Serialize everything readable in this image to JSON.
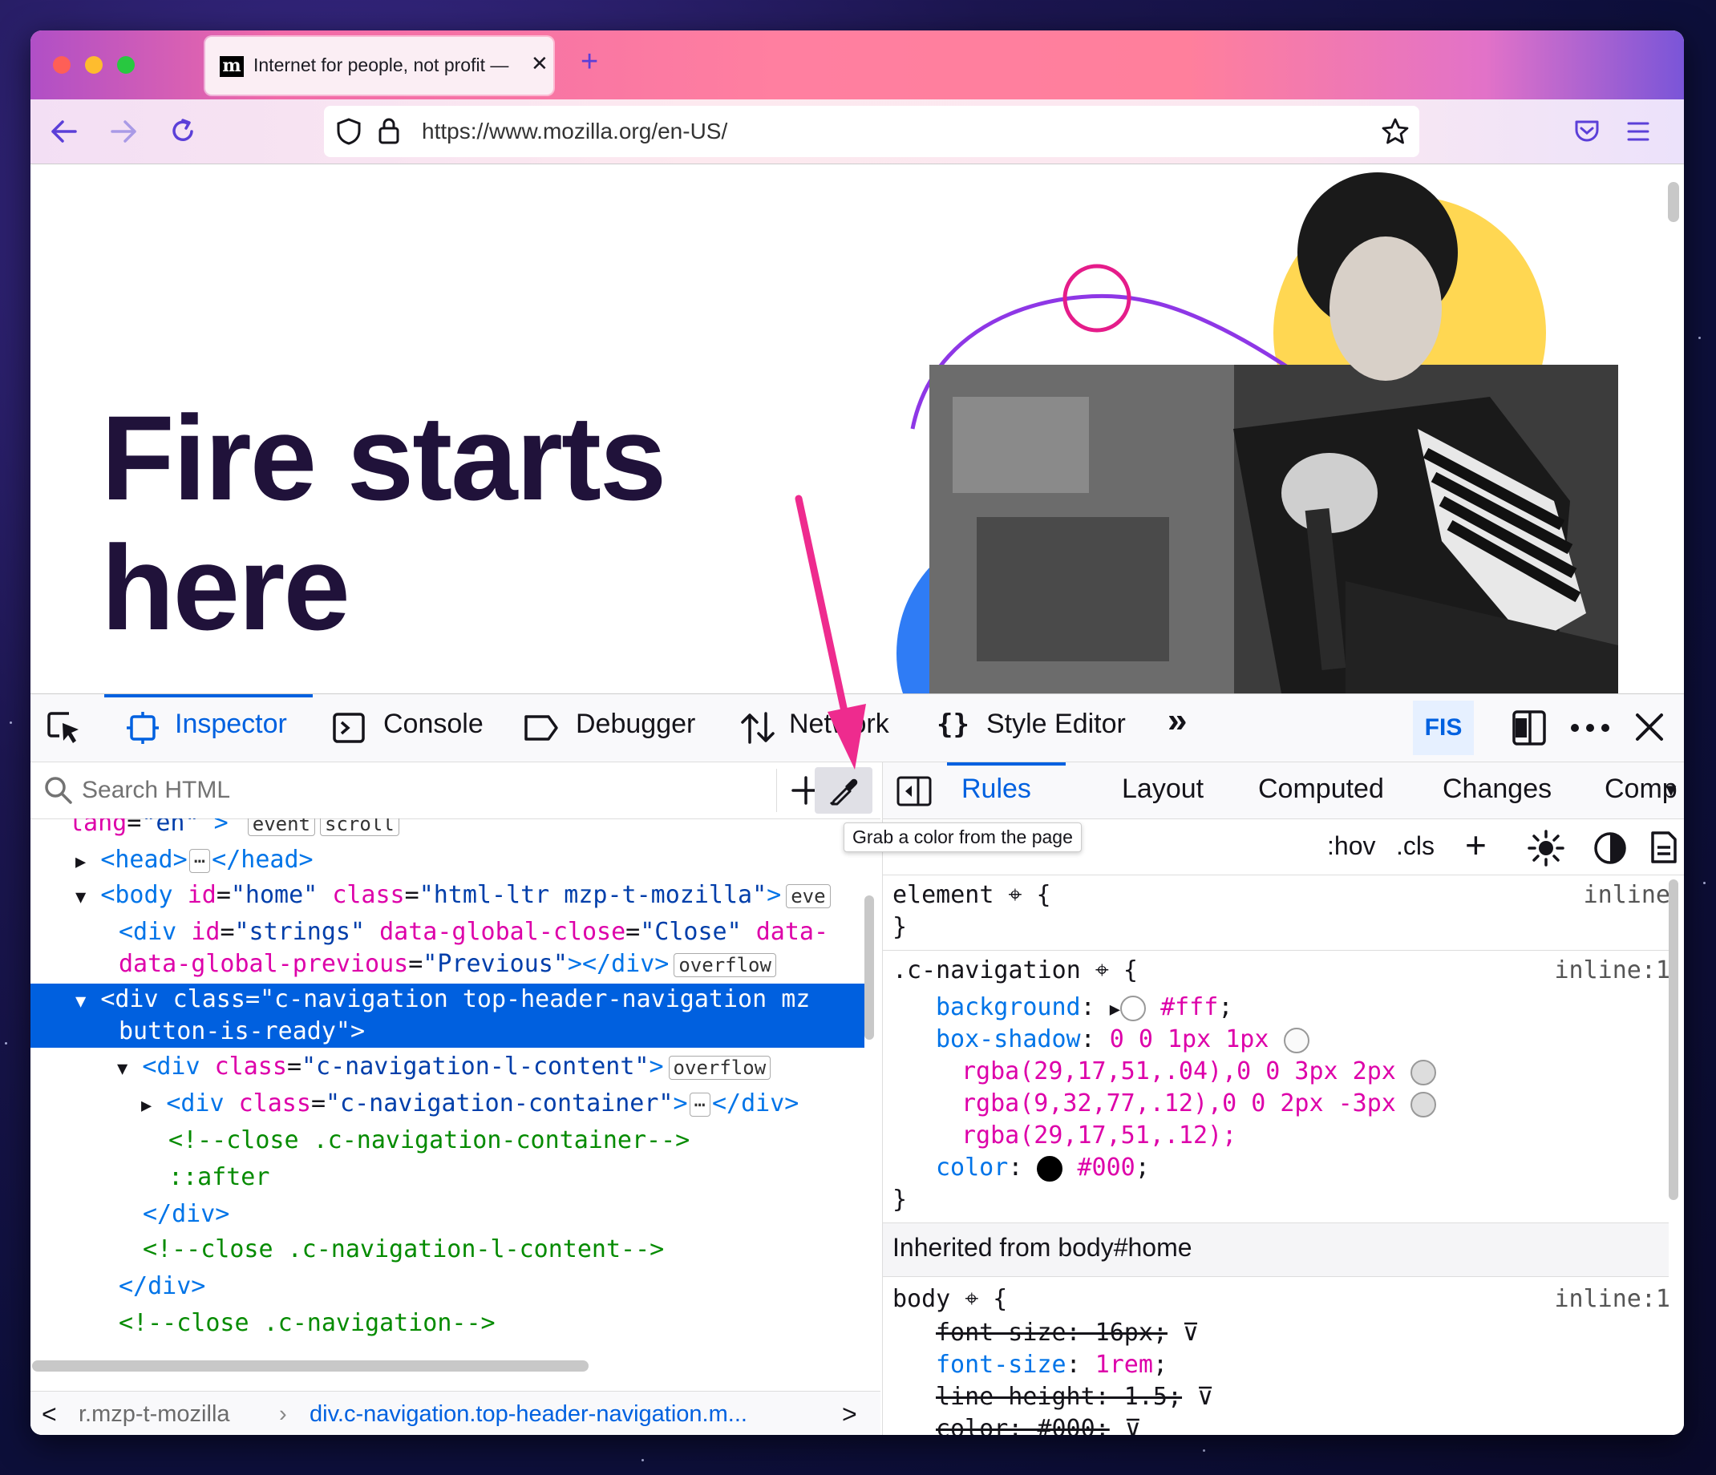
{
  "tab": {
    "title": "Internet for people, not profit —",
    "favicon": "m",
    "close": "✕"
  },
  "newtab": "+",
  "url": "https://www.mozilla.org/en-US/",
  "page": {
    "hero_line1": "Fire starts",
    "hero_line2": "here"
  },
  "devtools": {
    "tabs": [
      "Inspector",
      "Console",
      "Debugger",
      "Network",
      "Style Editor"
    ],
    "more": "»",
    "fis": "FIS",
    "search_placeholder": "Search HTML",
    "tooltip": "Grab a color from the page",
    "tree": {
      "l0": [
        "lang",
        "=",
        "\"en\"",
        ">",
        "event",
        "scroll"
      ],
      "l1": {
        "open": "<head>",
        "close": "</head>"
      },
      "l2": {
        "tag": "<body",
        "a1": "id",
        "v1": "\"home\"",
        "a2": "class",
        "v2": "\"html-ltr mzp-t-mozilla\"",
        "end": ">",
        "badge": "eve"
      },
      "l3": {
        "tag": "<div",
        "a1": "id",
        "v1": "\"strings\"",
        "a2": "data-global-close",
        "v2": "\"Close\"",
        "a3": "data-"
      },
      "l4": {
        "a": "data-global-previous",
        "v": "\"Previous\"",
        "end": "></div>",
        "badge": "overflow"
      },
      "l5": {
        "tag": "<div",
        "a": "class",
        "v": "\"c-navigation top-header-navigation mz"
      },
      "l6": {
        "v": "button-is-ready\"",
        "end": ">"
      },
      "l7": {
        "tag": "<div",
        "a": "class",
        "v": "\"c-navigation-l-content\"",
        "end": ">",
        "badge": "overflow"
      },
      "l8": {
        "tag": "<div",
        "a": "class",
        "v": "\"c-navigation-container\"",
        "end": ">",
        "close": "</div>"
      },
      "l9": "<!--close .c-navigation-container-->",
      "l10": "::after",
      "l11": "</div>",
      "l12": "<!--close .c-navigation-l-content-->",
      "l13": "</div>",
      "l14": "<!--close .c-navigation-->"
    },
    "breadcrumbs": {
      "prev": "<",
      "item1": "r.mzp-t-mozilla",
      "item2": "div.c-navigation.top-header-navigation.m...",
      "next": ">"
    },
    "right_tabs": [
      "Rules",
      "Layout",
      "Computed",
      "Changes",
      "Comp"
    ],
    "filter": {
      "hov": ":hov",
      "cls": ".cls",
      "add": "+"
    },
    "rules": {
      "element_sel": "element",
      "element_src": "inline",
      "nav_sel": ".c-navigation",
      "nav_src": "inline:1",
      "p1": "background",
      "v1": "#fff",
      "p2": "box-shadow",
      "v2": "0 0 1px 1px",
      "v2b": "rgba(29,17,51,.04),0 0 3px 2px",
      "v2c": "rgba(9,32,77,.12),0 0 2px -3px",
      "v2d": "rgba(29,17,51,.12);",
      "p3": "color",
      "v3": "#000",
      "inherited": "Inherited from body#home",
      "body_sel": "body",
      "body_src": "inline:1",
      "b1": "font-size: 16px;",
      "b2p": "font-size",
      "b2v": "1rem",
      "b3": "line-height: 1.5;",
      "b4": "color: #000;"
    }
  },
  "colors": {
    "accent": "#0061e0",
    "selection": "#0060df",
    "arrow": "#ee2b8e",
    "hero": "#20123a"
  }
}
